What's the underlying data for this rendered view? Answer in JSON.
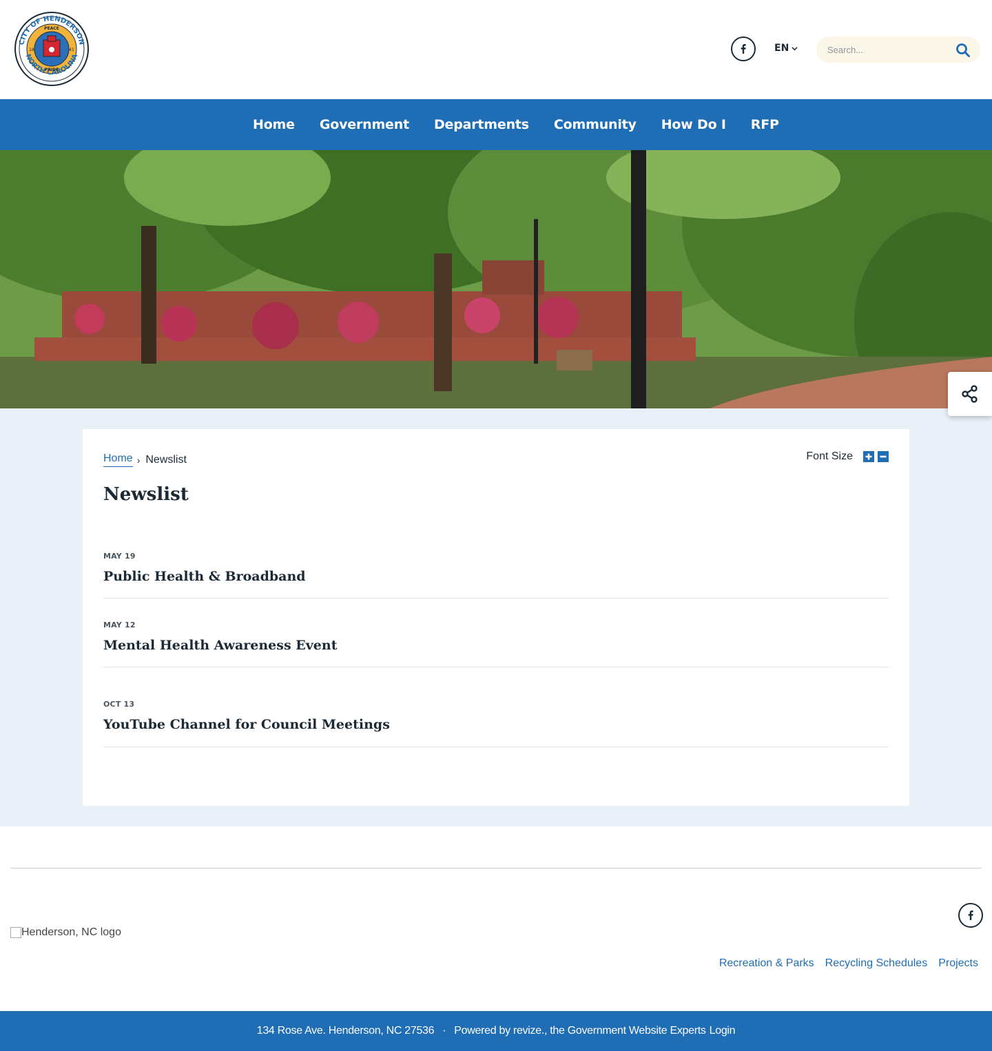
{
  "header": {
    "logo_text": {
      "top": "CITY OF HENDERSON",
      "bottom": "NORTH CAROLINA",
      "words": [
        "PEACE",
        "PROGRESS",
        "PROSPERITY",
        "PRIDE"
      ],
      "year_left": "18",
      "year_right": "41"
    },
    "facebook_icon": "facebook-icon",
    "language": "EN",
    "search_placeholder": "Search..."
  },
  "nav": {
    "items": [
      "Home",
      "Government",
      "Departments",
      "Community",
      "How Do I",
      "RFP"
    ]
  },
  "breadcrumb": {
    "home": "Home",
    "current": "Newslist"
  },
  "font_size": {
    "label": "Font Size"
  },
  "page": {
    "title": "Newslist"
  },
  "news": [
    {
      "date": "MAY 19",
      "title": "Public Health & Broadband"
    },
    {
      "date": "MAY 12",
      "title": "Mental Health Awareness Event"
    },
    {
      "date": "OCT 13",
      "title": "YouTube Channel for Council Meetings"
    }
  ],
  "footer": {
    "logo_alt": "Henderson, NC logo",
    "links": [
      "Recreation & Parks",
      "Recycling Schedules",
      "Projects"
    ],
    "address": "134 Rose Ave. Henderson, NC 27536",
    "separator": "·",
    "powered": "Powered by revize., the Government Website Experts",
    "login": "Login"
  },
  "colors": {
    "primary": "#1f6db5",
    "text": "#1c2a36",
    "content_bg": "#eaf0f8",
    "search_bg": "#fbf7e8"
  }
}
